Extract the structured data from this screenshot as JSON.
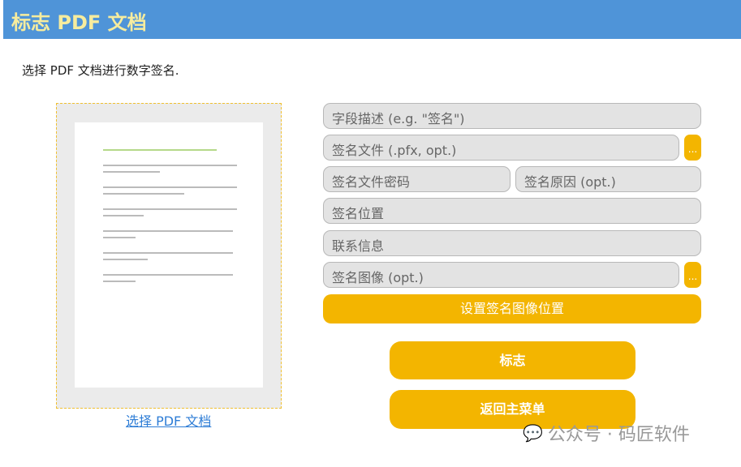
{
  "header": {
    "title": "标志 PDF 文档"
  },
  "subtitle": "选择 PDF 文档进行数字签名.",
  "preview": {
    "select_link": "选择 PDF 文档"
  },
  "fields": {
    "field_description": "字段描述 (e.g. \"签名\")",
    "signature_file": "签名文件 (.pfx, opt.)",
    "signature_password": "签名文件密码",
    "signature_reason": "签名原因 (opt.)",
    "signature_location": "签名位置",
    "contact_info": "联系信息",
    "signature_image": "签名图像 (opt.)",
    "browse": "..."
  },
  "buttons": {
    "set_image_position": "设置签名图像位置",
    "sign": "标志",
    "back": "返回主菜单"
  },
  "watermark": "公众号 · 码匠软件",
  "colors": {
    "header": "#4f94d8",
    "accent": "#f3b500"
  }
}
